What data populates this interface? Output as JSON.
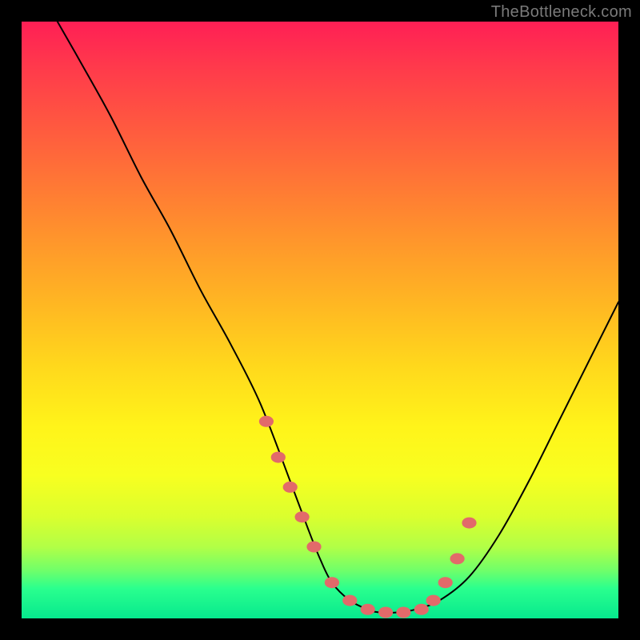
{
  "watermark": "TheBottleneck.com",
  "colors": {
    "background": "#000000",
    "gradient_top": "#ff1f55",
    "gradient_bottom": "#06e98e",
    "curve": "#000000",
    "markers": "#e26a6a"
  },
  "chart_data": {
    "type": "line",
    "title": "",
    "xlabel": "",
    "ylabel": "",
    "xlim": [
      0,
      100
    ],
    "ylim": [
      0,
      100
    ],
    "grid": false,
    "legend": false,
    "series": [
      {
        "name": "bottleneck-curve",
        "x": [
          6,
          10,
          15,
          20,
          25,
          30,
          35,
          40,
          45,
          48,
          50,
          52,
          55,
          58,
          60,
          63,
          66,
          70,
          75,
          80,
          85,
          90,
          95,
          100
        ],
        "values": [
          100,
          93,
          84,
          74,
          65,
          55,
          46,
          36,
          23,
          15,
          10,
          6,
          3,
          1.5,
          1,
          1,
          1.5,
          3,
          7,
          14,
          23,
          33,
          43,
          53
        ]
      }
    ],
    "markers": {
      "name": "highlighted-points",
      "x": [
        41,
        43,
        45,
        47,
        49,
        52,
        55,
        58,
        61,
        64,
        67,
        69,
        71,
        73,
        75
      ],
      "values": [
        33,
        27,
        22,
        17,
        12,
        6,
        3,
        1.5,
        1,
        1,
        1.5,
        3,
        6,
        10,
        16
      ],
      "radius_px": 7
    }
  }
}
